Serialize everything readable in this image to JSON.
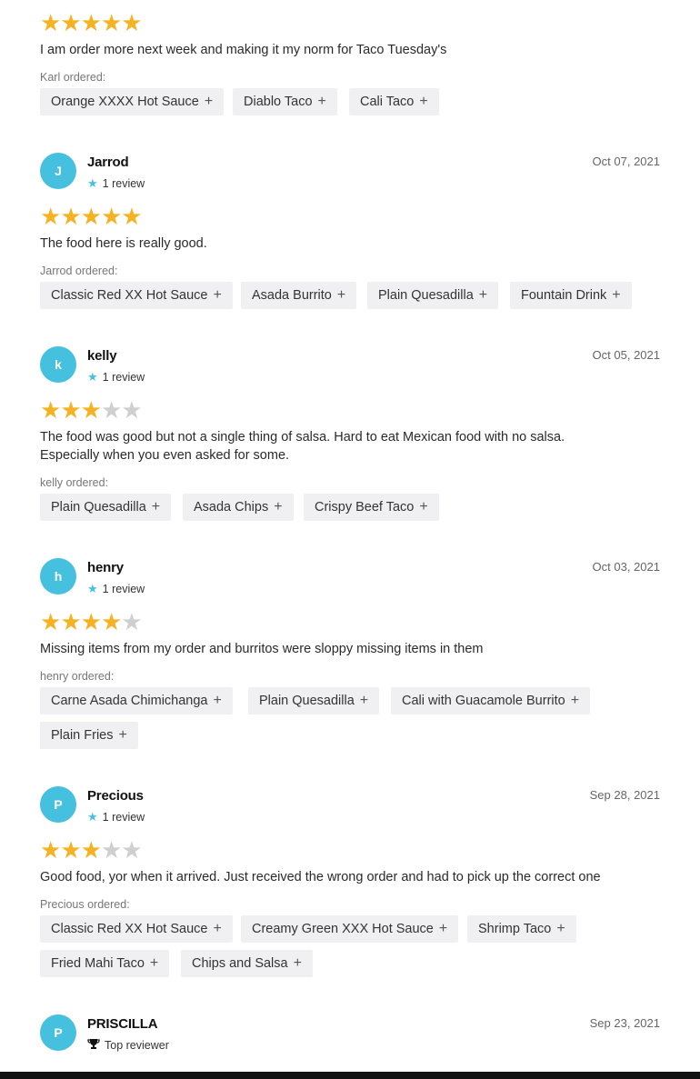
{
  "colors": {
    "star_on": "#f5b324",
    "star_off": "#cfcfcf",
    "avatar": "#45c0de"
  },
  "top": {
    "rating": 5,
    "text": "I am order more next week and making it my norm for Taco Tuesday's",
    "ordered_label": "Karl ordered:",
    "items": [
      "Orange XXXX Hot Sauce",
      "Diablo Taco",
      "Cali Taco"
    ]
  },
  "reviews": [
    {
      "initial": "J",
      "name": "Jarrod",
      "meta": "1 review",
      "date": "Oct 07, 2021",
      "rating": 5,
      "text": "The food here is really good.",
      "ordered_label": "Jarrod ordered:",
      "items": [
        "Classic Red XX Hot Sauce",
        "Asada Burrito",
        "Plain Quesadilla",
        "Fountain Drink"
      ]
    },
    {
      "initial": "k",
      "name": "kelly",
      "meta": "1 review",
      "date": "Oct 05, 2021",
      "rating": 3,
      "text_line1": "The food was good but not a single thing of salsa. Hard to eat Mexican food with no salsa.",
      "text_line2": "Especially when you even asked for some.",
      "ordered_label": "kelly ordered:",
      "items": [
        "Plain Quesadilla",
        "Asada Chips",
        "Crispy Beef Taco"
      ]
    },
    {
      "initial": "h",
      "name": "henry",
      "meta": "1 review",
      "date": "Oct 03, 2021",
      "rating": 4,
      "text": "Missing items from my order and burritos were sloppy missing items in them",
      "ordered_label": "henry ordered:",
      "items": [
        "Carne Asada Chimichanga",
        "Plain Quesadilla",
        "Cali with Guacamole Burrito",
        "Plain Fries"
      ]
    },
    {
      "initial": "P",
      "name": "Precious",
      "meta": "1 review",
      "date": "Sep 28, 2021",
      "rating": 3,
      "text": "Good food, yor when it arrived. Just received the wrong order and had to pick up the correct one",
      "ordered_label": "Precious ordered:",
      "items": [
        "Classic Red XX Hot Sauce",
        "Creamy Green XXX Hot Sauce",
        "Shrimp Taco",
        "Fried Mahi Taco",
        "Chips and Salsa"
      ]
    },
    {
      "initial": "P",
      "name": "PRISCILLA",
      "meta": "Top reviewer",
      "date": "Sep 23, 2021"
    }
  ],
  "icons": {
    "star": "star-icon",
    "plus": "plus-icon",
    "trophy": "trophy-icon",
    "review_star": "review-count-star-icon"
  }
}
